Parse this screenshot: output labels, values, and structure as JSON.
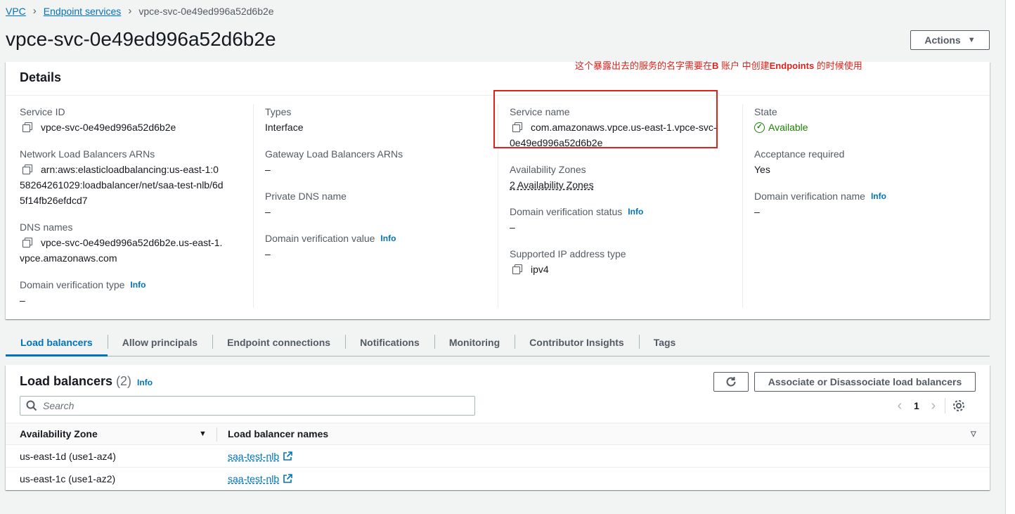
{
  "breadcrumb": {
    "root": "VPC",
    "section": "Endpoint services",
    "current": "vpce-svc-0e49ed996a52d6b2e"
  },
  "page": {
    "title": "vpce-svc-0e49ed996a52d6b2e",
    "actions_label": "Actions"
  },
  "annotation": {
    "text_before": "这个暴露出去的服务的名字需要在",
    "bold1": "B",
    "text_mid": " 账户  中创建",
    "bold2": "Endpoints",
    "text_after": " 的时候使用",
    "color": "#e0201a"
  },
  "details": {
    "heading": "Details",
    "service_id_label": "Service ID",
    "service_id": "vpce-svc-0e49ed996a52d6b2e",
    "nlb_arns_label": "Network Load Balancers ARNs",
    "nlb_arns": "arn:aws:elasticloadbalancing:us-east-1:058264261029:loadbalancer/net/saa-test-nlb/6d5f14fb26efdcd7",
    "dns_names_label": "DNS names",
    "dns_names": "vpce-svc-0e49ed996a52d6b2e.us-east-1.vpce.amazonaws.com",
    "domain_verification_type_label": "Domain verification type",
    "domain_verification_type": "–",
    "types_label": "Types",
    "types": "Interface",
    "gwlb_arns_label": "Gateway Load Balancers ARNs",
    "gwlb_arns": "–",
    "private_dns_label": "Private DNS name",
    "private_dns": "–",
    "domain_verification_value_label": "Domain verification value",
    "domain_verification_value": "–",
    "service_name_label": "Service name",
    "service_name": "com.amazonaws.vpce.us-east-1.vpce-svc-0e49ed996a52d6b2e",
    "az_label": "Availability Zones",
    "az": "2 Availability Zones",
    "domain_verification_status_label": "Domain verification status",
    "domain_verification_status": "–",
    "supported_ip_label": "Supported IP address type",
    "supported_ip": "ipv4",
    "state_label": "State",
    "state": "Available",
    "acceptance_label": "Acceptance required",
    "acceptance": "Yes",
    "domain_verification_name_label": "Domain verification name",
    "domain_verification_name": "–",
    "info": "Info"
  },
  "tabs": [
    "Load balancers",
    "Allow principals",
    "Endpoint connections",
    "Notifications",
    "Monitoring",
    "Contributor Insights",
    "Tags"
  ],
  "load_balancers": {
    "title": "Load balancers",
    "count": "(2)",
    "info": "Info",
    "associate_label": "Associate or Disassociate load balancers",
    "search_placeholder": "Search",
    "page": "1",
    "columns": [
      "Availability Zone",
      "Load balancer names"
    ],
    "rows": [
      {
        "az": "us-east-1d (use1-az4)",
        "name": "saa-test-nlb"
      },
      {
        "az": "us-east-1c (use1-az2)",
        "name": "saa-test-nlb"
      }
    ]
  },
  "colors": {
    "link": "#0073bb",
    "success": "#1d8102",
    "annotation": "#e0201a"
  }
}
